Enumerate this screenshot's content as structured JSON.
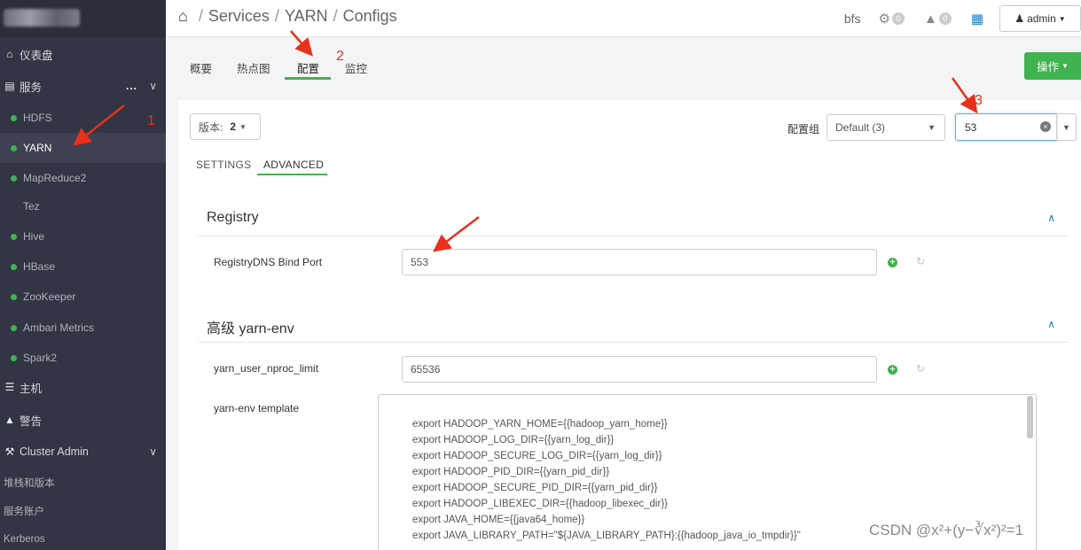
{
  "sidebar": {
    "items": [
      {
        "label": "仪表盘",
        "icon": "home-icon"
      },
      {
        "label": "服务",
        "icon": "briefcase-icon"
      },
      {
        "label": "HDFS"
      },
      {
        "label": "YARN"
      },
      {
        "label": "MapReduce2"
      },
      {
        "label": "Tez"
      },
      {
        "label": "Hive"
      },
      {
        "label": "HBase"
      },
      {
        "label": "ZooKeeper"
      },
      {
        "label": "Ambari Metrics"
      },
      {
        "label": "Spark2"
      },
      {
        "label": "主机",
        "icon": "server-icon"
      },
      {
        "label": "警告",
        "icon": "bell-icon"
      },
      {
        "label": "Cluster Admin",
        "icon": "wrench-icon"
      },
      {
        "label": "堆栈和版本"
      },
      {
        "label": "服务账户"
      },
      {
        "label": "Kerberos"
      }
    ],
    "services_more": "..."
  },
  "header": {
    "breadcrumb": [
      "Services",
      "YARN",
      "Configs"
    ],
    "cluster_name": "bfs",
    "ops_count": "0",
    "alerts_count": "0",
    "user": "admin"
  },
  "tabs": [
    "概要",
    "热点图",
    "配置",
    "监控"
  ],
  "actions_button": "操作",
  "toolbar": {
    "version_label": "版本:",
    "version_value": "2",
    "config_group_label": "配置组",
    "config_group_value": "Default (3)",
    "search_value": "53"
  },
  "subtabs": [
    "SETTINGS",
    "ADVANCED"
  ],
  "sections": [
    {
      "title": "Registry",
      "props": [
        {
          "label": "RegistryDNS Bind Port",
          "value": "553"
        }
      ]
    },
    {
      "title": "高级 yarn-env",
      "props": [
        {
          "label": "yarn_user_nproc_limit",
          "value": "65536"
        },
        {
          "label": "yarn-env template"
        }
      ]
    }
  ],
  "template_lines": [
    "export HADOOP_YARN_HOME={{hadoop_yarn_home}}",
    "export HADOOP_LOG_DIR={{yarn_log_dir}}",
    "export HADOOP_SECURE_LOG_DIR={{yarn_log_dir}}",
    "export HADOOP_PID_DIR={{yarn_pid_dir}}",
    "export HADOOP_SECURE_PID_DIR={{yarn_pid_dir}}",
    "export HADOOP_LIBEXEC_DIR={{hadoop_libexec_dir}}",
    "export JAVA_HOME={{java64_home}}",
    "export JAVA_LIBRARY_PATH=\"${JAVA_LIBRARY_PATH}:{{hadoop_java_io_tmpdir}}\""
  ],
  "annotations": [
    "1",
    "2",
    "3"
  ],
  "watermark": "CSDN @x²+(y−∛x²)²=1",
  "colors": {
    "accent_green": "#3fb34f",
    "sidebar_bg": "#323544",
    "annotation_red": "#e8301c",
    "link_blue": "#1f7cc4"
  }
}
